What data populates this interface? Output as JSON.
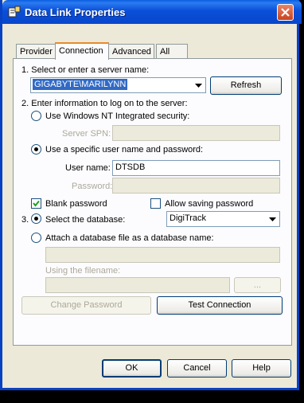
{
  "window": {
    "title": "Data Link Properties"
  },
  "tabs": [
    {
      "label": "Provider"
    },
    {
      "label": "Connection"
    },
    {
      "label": "Advanced"
    },
    {
      "label": "All"
    }
  ],
  "step1": {
    "label": "1. Select or enter a server name:",
    "server_value": "GIGABYTE\\MARILYNN",
    "refresh_label": "Refresh"
  },
  "step2": {
    "label": "2. Enter information to log on to the server:",
    "nt_security_label": "Use Windows NT Integrated security:",
    "server_spn_label": "Server SPN:",
    "server_spn_value": "",
    "specific_user_label": "Use a specific user name and password:",
    "username_label": "User name:",
    "username_value": "DTSDB",
    "password_label": "Password:",
    "password_value": "",
    "blank_password_label": "Blank password",
    "blank_password_checked": true,
    "allow_saving_label": "Allow saving password",
    "allow_saving_checked": false
  },
  "step3": {
    "prefix": "3.",
    "select_db_label": "Select the database:",
    "db_value": "DigiTrack",
    "attach_label": "Attach a database file as a database name:",
    "attach_value": "",
    "filename_label": "Using the filename:",
    "filename_value": "",
    "browse_label": "..."
  },
  "buttons": {
    "change_password": "Change Password",
    "test_connection": "Test Connection",
    "ok": "OK",
    "cancel": "Cancel",
    "help": "Help"
  }
}
